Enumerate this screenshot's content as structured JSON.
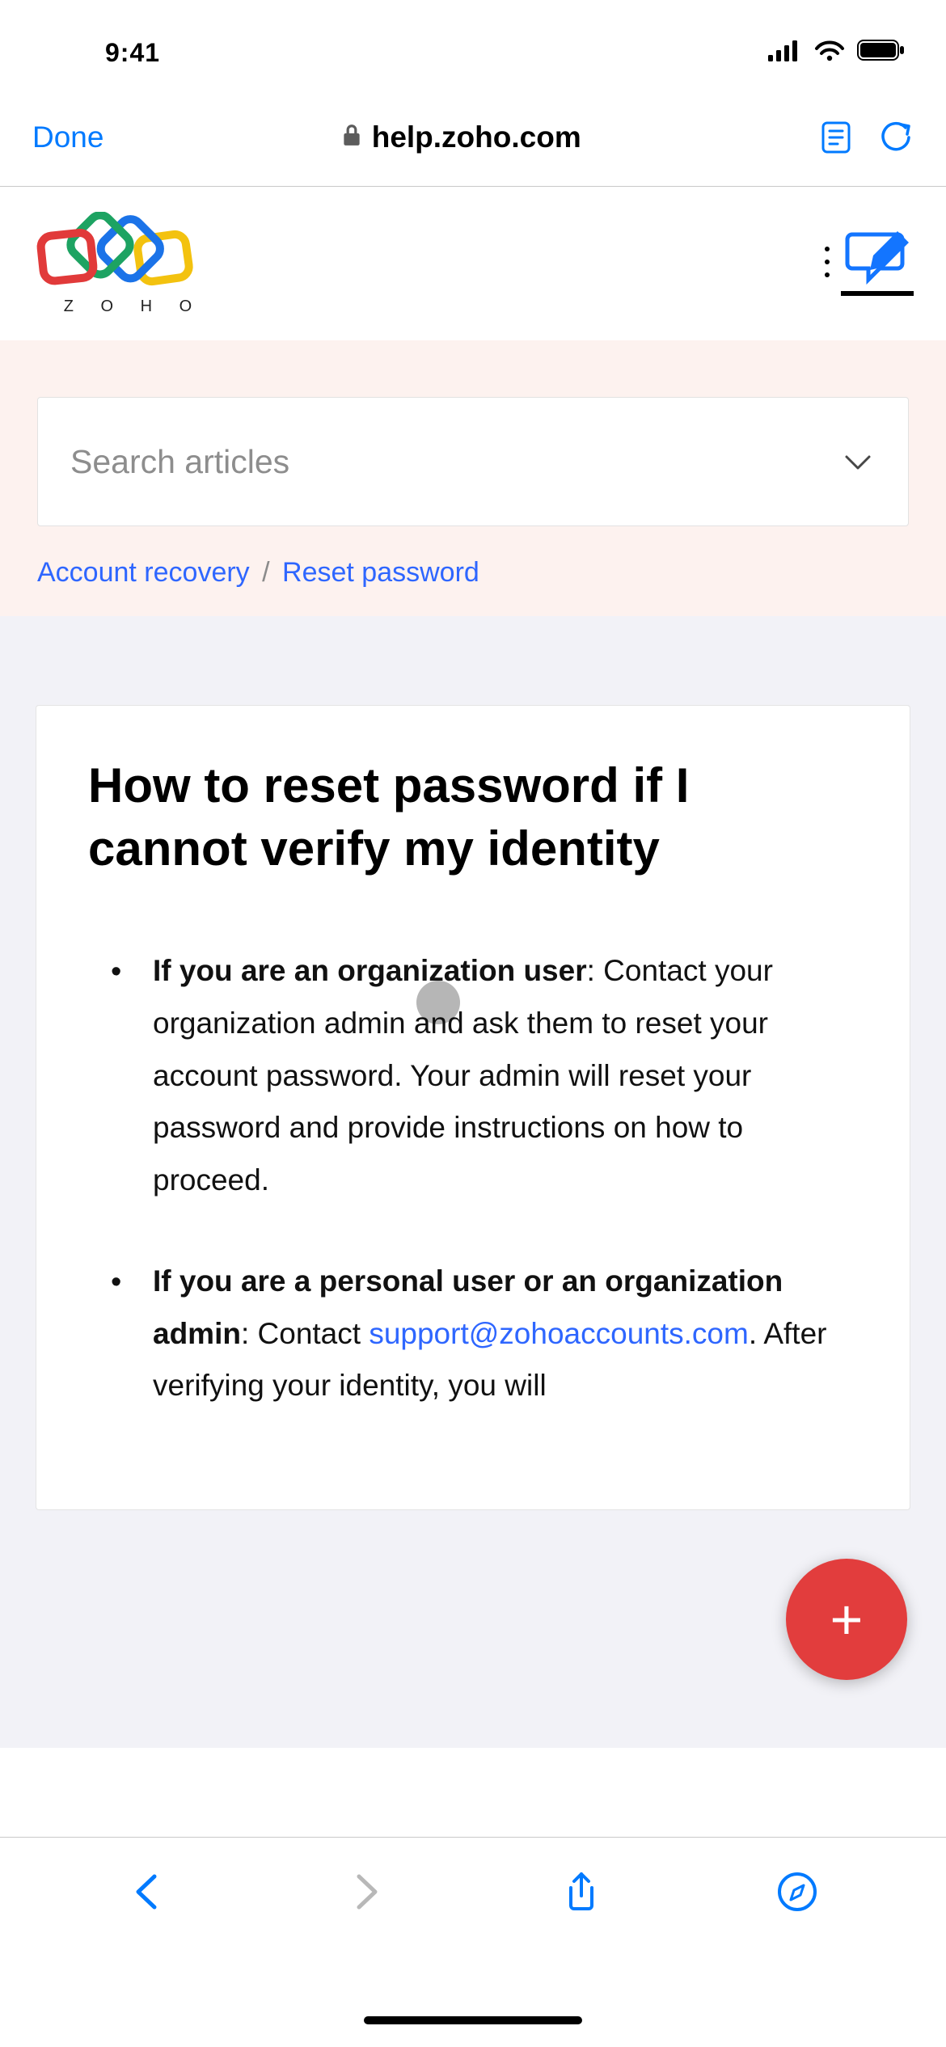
{
  "status": {
    "time": "9:41"
  },
  "safari": {
    "done_label": "Done",
    "url_host": "help.zoho.com"
  },
  "header": {
    "brand_letters": "Z O H O"
  },
  "search": {
    "placeholder": "Search articles"
  },
  "breadcrumb": {
    "items": [
      "Account recovery",
      "Reset password"
    ],
    "sep": "/"
  },
  "article": {
    "title": "How to reset password if I cannot verify my identity",
    "bullets": [
      {
        "lead": "If you are an organization user",
        "lead_suffix": ": ",
        "body_pre": "Contact your organization admin and ask them to reset your account password. Your admin will reset your password and provide instructions on how to proceed.",
        "link": "",
        "body_post": ""
      },
      {
        "lead": "If you are a personal user or an organization admin",
        "lead_suffix": ": ",
        "body_pre": "Contact ",
        "link": "support@zohoaccounts.com",
        "body_post": ". After verifying your identity, you will"
      }
    ]
  },
  "fab": {
    "glyph": "+"
  }
}
